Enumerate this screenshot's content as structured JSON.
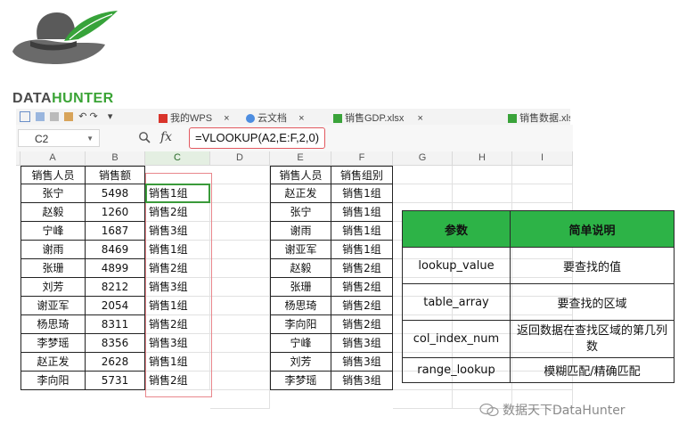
{
  "brand": {
    "word_dark": "DATA",
    "word_accent": "HUNTER"
  },
  "tabs": [
    {
      "label": "我的WPS"
    },
    {
      "label": "云文档"
    },
    {
      "label": "销售GDP.xlsx"
    },
    {
      "label": "销售数据.xlsx"
    }
  ],
  "formula_bar": {
    "cell_ref": "C2",
    "fx_label": "fx",
    "formula": "=VLOOKUP(A2,E:F,2,0)"
  },
  "columns": [
    "A",
    "B",
    "C",
    "D",
    "E",
    "F",
    "G",
    "H",
    "I"
  ],
  "table_left": {
    "headers": [
      "销售人员",
      "销售额"
    ],
    "rows": [
      [
        "张宁",
        "5498",
        "销售1组"
      ],
      [
        "赵毅",
        "1260",
        "销售2组"
      ],
      [
        "宁峰",
        "1687",
        "销售3组"
      ],
      [
        "谢雨",
        "8469",
        "销售1组"
      ],
      [
        "张珊",
        "4899",
        "销售2组"
      ],
      [
        "刘芳",
        "8212",
        "销售3组"
      ],
      [
        "谢亚军",
        "2054",
        "销售1组"
      ],
      [
        "杨思琦",
        "8311",
        "销售2组"
      ],
      [
        "李梦瑶",
        "8356",
        "销售3组"
      ],
      [
        "赵正发",
        "2628",
        "销售1组"
      ],
      [
        "李向阳",
        "5731",
        "销售2组"
      ]
    ]
  },
  "table_right": {
    "headers": [
      "销售人员",
      "销售组别"
    ],
    "rows": [
      [
        "赵正发",
        "销售1组"
      ],
      [
        "张宁",
        "销售1组"
      ],
      [
        "谢雨",
        "销售1组"
      ],
      [
        "谢亚军",
        "销售1组"
      ],
      [
        "赵毅",
        "销售2组"
      ],
      [
        "张珊",
        "销售2组"
      ],
      [
        "杨思琦",
        "销售2组"
      ],
      [
        "李向阳",
        "销售2组"
      ],
      [
        "宁峰",
        "销售3组"
      ],
      [
        "刘芳",
        "销售3组"
      ],
      [
        "李梦瑶",
        "销售3组"
      ]
    ]
  },
  "info_table": {
    "headers": [
      "参数",
      "简单说明"
    ],
    "rows": [
      [
        "lookup_value",
        "要查找的值"
      ],
      [
        "table_array",
        "要查找的区域"
      ],
      [
        "col_index_num",
        "返回数据在查找区域的第几列数"
      ],
      [
        "range_lookup",
        "模糊匹配/精确匹配"
      ]
    ]
  },
  "watermark": "数据天下DataHunter",
  "colors": {
    "accent_green": "#2db347",
    "highlight_red": "#e2585f",
    "selection": "#3a9a3a"
  }
}
